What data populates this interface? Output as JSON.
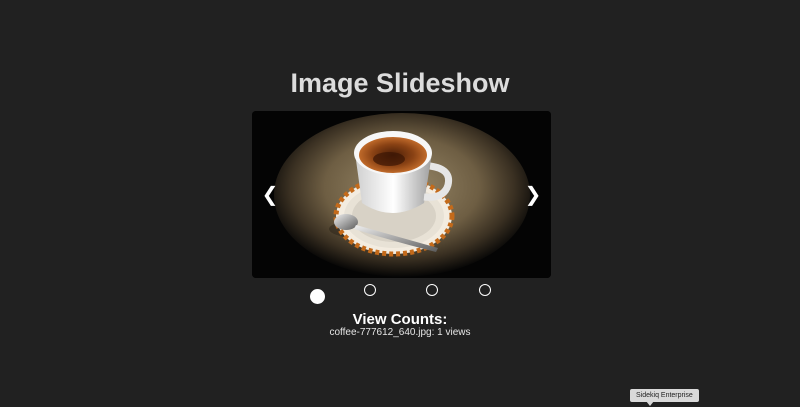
{
  "page": {
    "title": "Image Slideshow"
  },
  "slideshow": {
    "prev_label": "❮",
    "next_label": "❯",
    "slide_count": 4,
    "active_index": 0
  },
  "view_counts": {
    "heading": "View Counts:",
    "items": [
      "coffee-777612_640.jpg: 1 views"
    ]
  },
  "tooltip": {
    "text": "Sidekiq Enterprise"
  },
  "colors": {
    "background": "#212121",
    "text": "#ffffff"
  }
}
